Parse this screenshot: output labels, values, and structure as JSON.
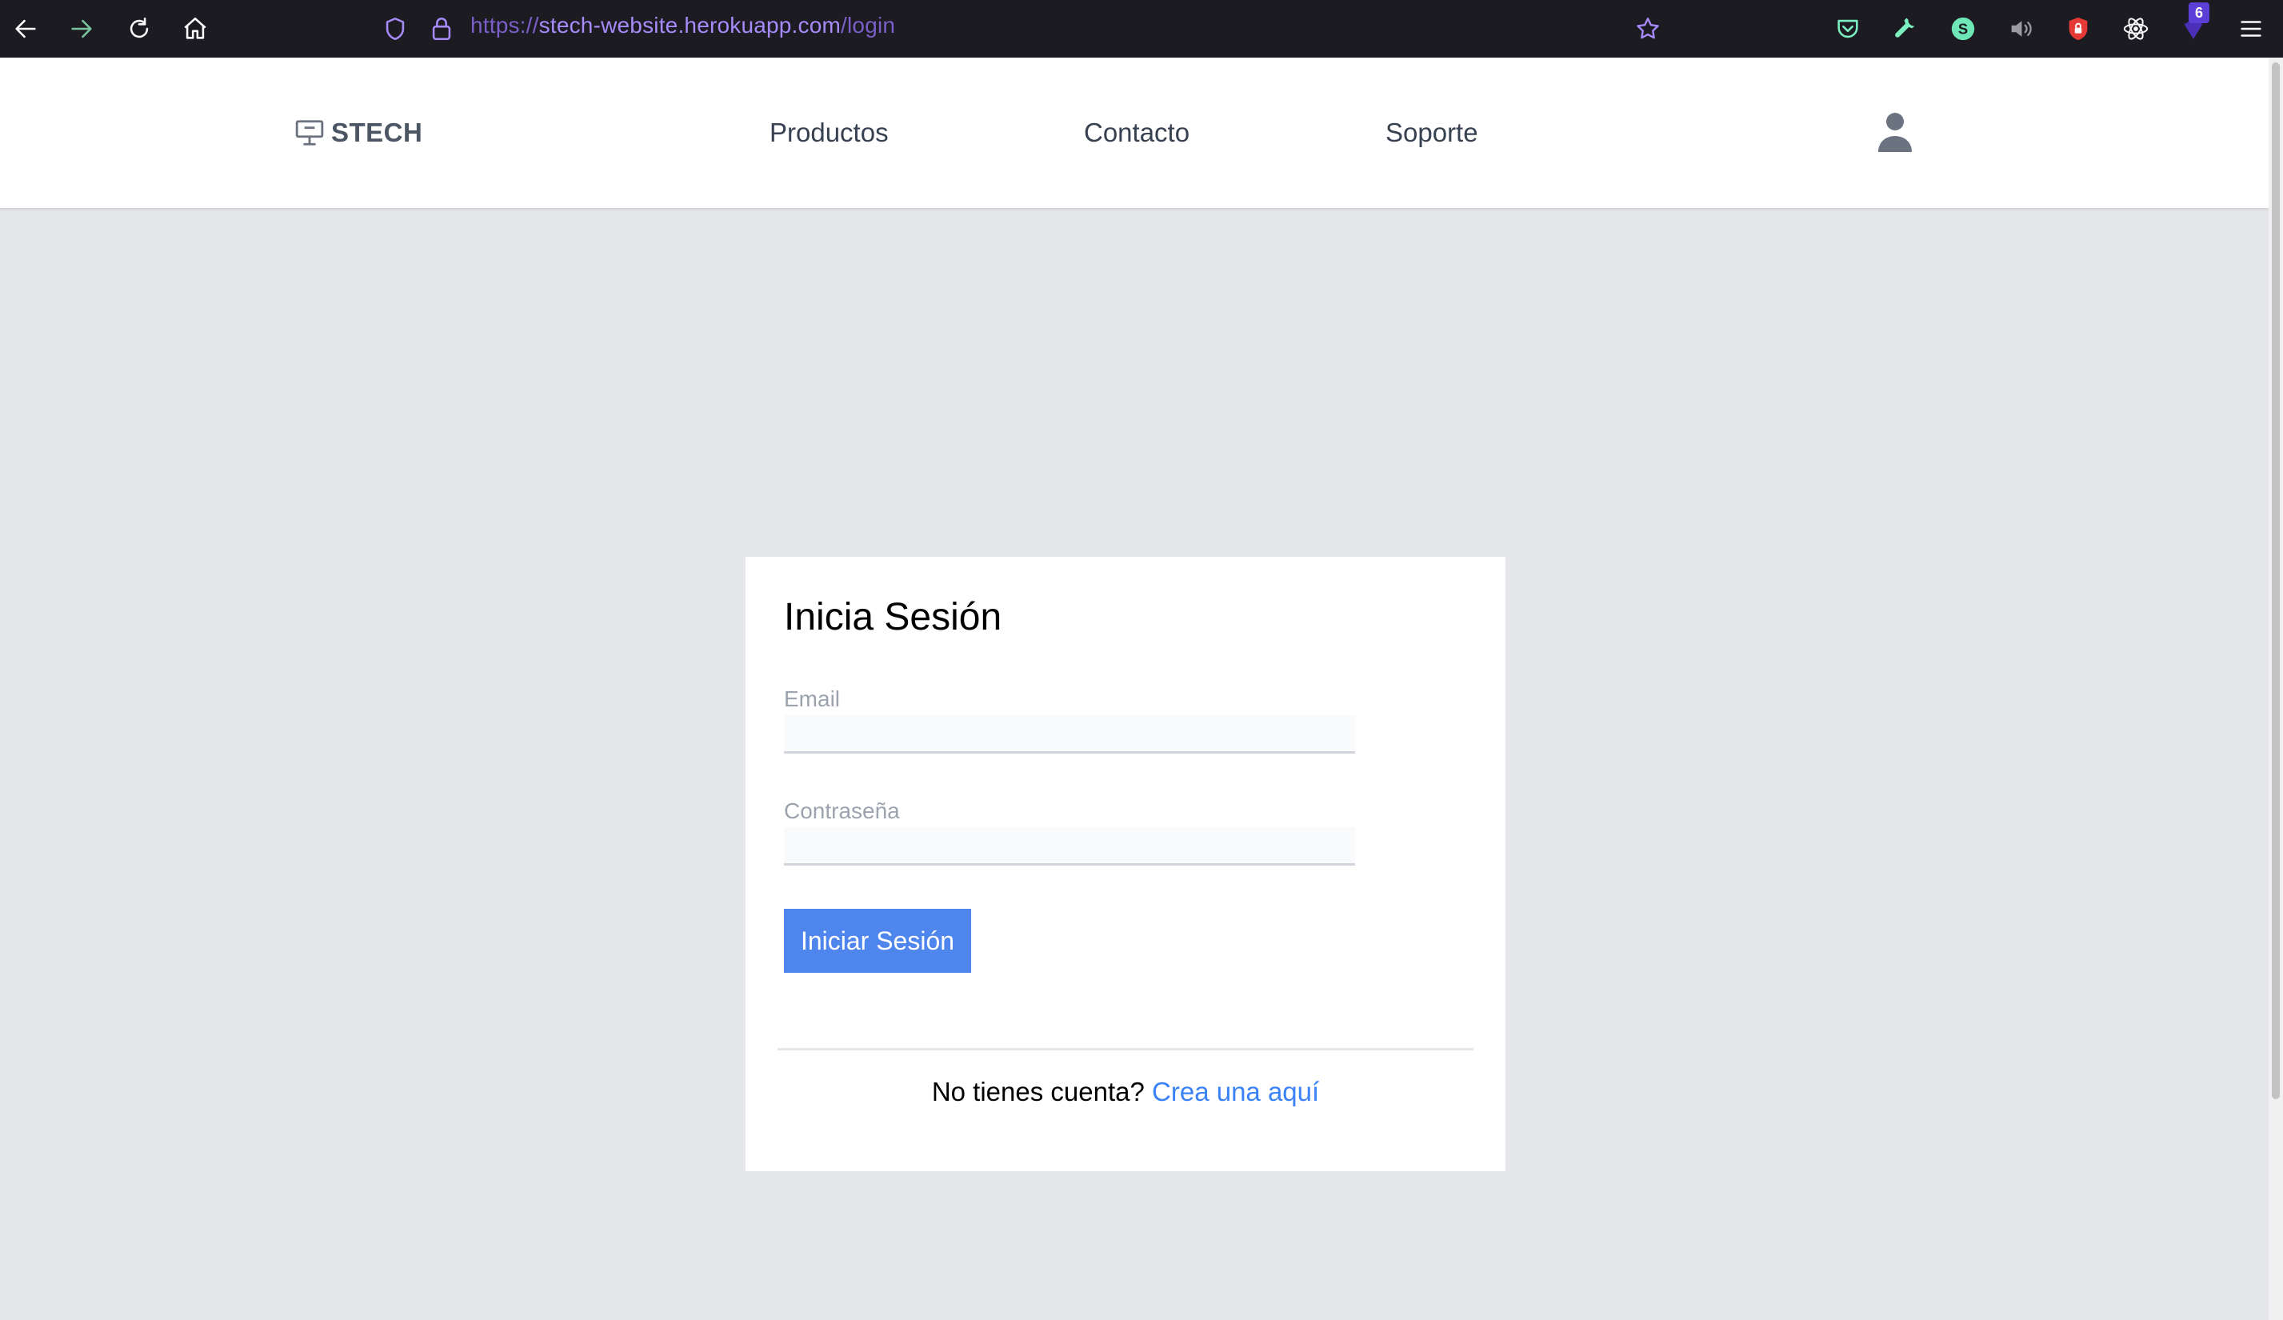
{
  "browser": {
    "url_scheme": "https://",
    "url_host": "stech-website.herokuapp.com",
    "url_path": "/login",
    "extension_badge": "6",
    "accent_color": "#a78bfa"
  },
  "header": {
    "brand": "STECH",
    "nav": [
      "Productos",
      "Contacto",
      "Soporte"
    ]
  },
  "login": {
    "title": "Inicia Sesión",
    "email_label": "Email",
    "email_value": "",
    "password_label": "Contraseña",
    "password_value": "",
    "submit_label": "Iniciar Sesión",
    "no_account_text": "No tienes cuenta?",
    "signup_link": "Crea una aquí",
    "button_color": "#4f86ee",
    "link_color": "#3b82f6"
  }
}
